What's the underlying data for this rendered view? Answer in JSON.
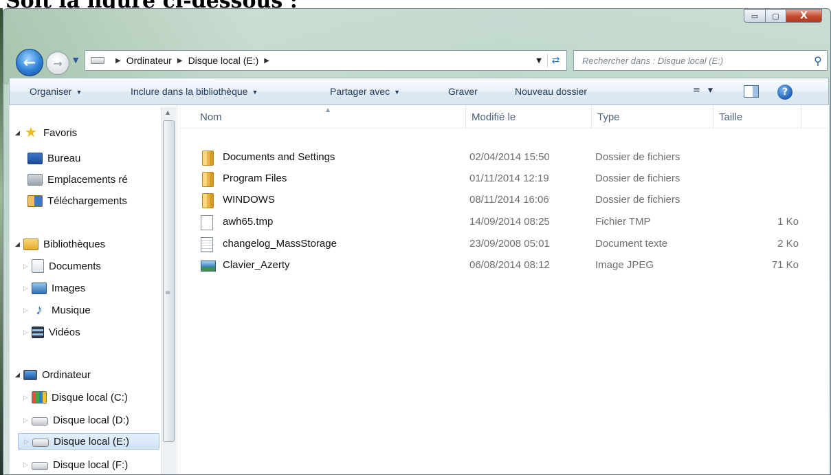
{
  "heading": "Soit la figure ci-dessous :",
  "window": {
    "caption": {
      "minimize": "▭",
      "maximize": "▢",
      "close": "X"
    }
  },
  "address": {
    "segments": [
      "Ordinateur",
      "Disque local (E:)"
    ],
    "separator": "▶"
  },
  "search": {
    "placeholder": "Rechercher dans : Disque local (E:)"
  },
  "toolbar": {
    "organise": "Organiser",
    "include": "Inclure dans la bibliothèque",
    "share": "Partager avec",
    "burn": "Graver",
    "new_folder": "Nouveau dossier"
  },
  "nav": {
    "favorites": "Favoris",
    "desktop": "Bureau",
    "recent_places": "Emplacements ré",
    "downloads": "Téléchargements",
    "libraries": "Bibliothèques",
    "documents": "Documents",
    "images": "Images",
    "music": "Musique",
    "videos": "Vidéos",
    "computer": "Ordinateur",
    "drive_c": "Disque local (C:)",
    "drive_d": "Disque local (D:)",
    "drive_e": "Disque local (E:)",
    "drive_f": "Disque local (F:)"
  },
  "columns": {
    "name": "Nom",
    "modified": "Modifié le",
    "type": "Type",
    "size": "Taille"
  },
  "files": [
    {
      "name": "Documents and Settings",
      "modified": "02/04/2014 15:50",
      "type": "Dossier de fichiers",
      "size": "",
      "icon": "folder-icon"
    },
    {
      "name": "Program Files",
      "modified": "01/11/2014 12:19",
      "type": "Dossier de fichiers",
      "size": "",
      "icon": "folder-icon"
    },
    {
      "name": "WINDOWS",
      "modified": "08/11/2014 16:06",
      "type": "Dossier de fichiers",
      "size": "",
      "icon": "folder-icon"
    },
    {
      "name": "awh65.tmp",
      "modified": "14/09/2014 08:25",
      "type": "Fichier TMP",
      "size": "1 Ko",
      "icon": "tmp-file-icon"
    },
    {
      "name": "changelog_MassStorage",
      "modified": "23/09/2008 05:01",
      "type": "Document texte",
      "size": "2 Ko",
      "icon": "text-file-icon"
    },
    {
      "name": "Clavier_Azerty",
      "modified": "06/08/2014 08:12",
      "type": "Image JPEG",
      "size": "71 Ko",
      "icon": "jpeg-file-icon"
    }
  ],
  "colors": {
    "selection": "#cfe4f7",
    "toolbar_text": "#1e395b",
    "column_header": "#4c607a"
  }
}
